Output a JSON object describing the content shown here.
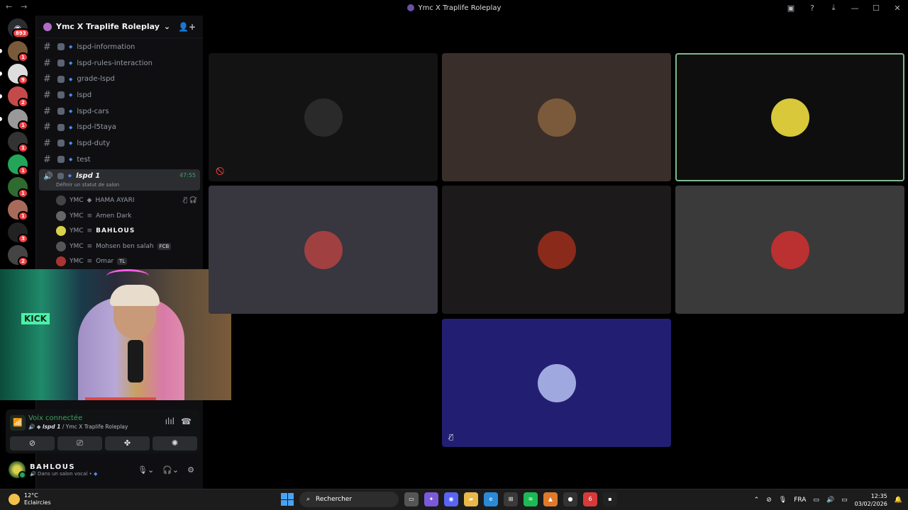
{
  "window": {
    "title": "Ymc X Traplife Roleplay",
    "back_icon": "←",
    "forward_icon": "→"
  },
  "rail": {
    "home_badge": "893",
    "servers": [
      {
        "badge": "1",
        "color": "#7a5a3a"
      },
      {
        "badge": "9",
        "color": "#ddd"
      },
      {
        "badge": "2",
        "color": "#c44a4a"
      },
      {
        "badge": "1",
        "color": "#999"
      },
      {
        "badge": "1",
        "color": "#333"
      },
      {
        "badge": "1",
        "color": "#23a55a"
      },
      {
        "badge": "1",
        "color": "#2f6a2f"
      },
      {
        "badge": "1",
        "color": "#a86a5a"
      },
      {
        "badge": "3",
        "color": "#222"
      },
      {
        "badge": "2",
        "color": "#444"
      }
    ]
  },
  "server": {
    "name": "Ymc X Traplife Roleplay",
    "chevron": "⌄",
    "add_member_icon": "👤+"
  },
  "channels": [
    {
      "name": "lspd-information"
    },
    {
      "name": "lspd-rules-interaction"
    },
    {
      "name": "grade-lspd"
    },
    {
      "name": "lspd"
    },
    {
      "name": "lspd-cars"
    },
    {
      "name": "lspd-l5taya"
    },
    {
      "name": "lspd-duty"
    },
    {
      "name": "test"
    }
  ],
  "voice_channel": {
    "name": "lspd 1",
    "timer": "47:55",
    "status": "Définir un statut de salon"
  },
  "members": [
    {
      "tag": "YMC",
      "name": "HAMA AYARI",
      "extra": "",
      "icons": "🎙̸ 🎧̸",
      "bold": false,
      "color": "#444"
    },
    {
      "tag": "YMC",
      "name": "Amen Dark",
      "extra": "",
      "icons": "",
      "bold": false,
      "color": "#666"
    },
    {
      "tag": "YMC",
      "name": "BAHLOUS",
      "extra": "",
      "icons": "",
      "bold": true,
      "color": "#d8d24a"
    },
    {
      "tag": "YMC",
      "name": "Mohsen ben salah",
      "extra": "FCB",
      "icons": "",
      "bold": false,
      "color": "#555"
    },
    {
      "tag": "YMC",
      "name": "Omar",
      "extra": "TL",
      "icons": "",
      "bold": false,
      "color": "#a33"
    }
  ],
  "webcam": {
    "sign": "KICK"
  },
  "voice_panel": {
    "connected": "Voix connectée",
    "location_channel": "lspd 1",
    "location_server": "/ Ymc X Traplife Roleplay"
  },
  "user": {
    "name": "BAHLOUS",
    "status": "Dans un salon vocal •"
  },
  "tiles": [
    {
      "bg": "#131313",
      "avatar": "#2a2a2a",
      "mute": "🚫"
    },
    {
      "bg": "#3a2e2b",
      "avatar": "#7a5a3a",
      "mute": ""
    },
    {
      "bg": "#0e0e0e",
      "avatar": "#d8c83a",
      "mute": ""
    },
    {
      "bg": "#38363f",
      "avatar": "#a04040",
      "mute": ""
    },
    {
      "bg": "#1d1a1c",
      "avatar": "#8a2a1a",
      "mute": ""
    },
    {
      "bg": "#3a3a3a",
      "avatar": "#bb3030",
      "mute": ""
    },
    {
      "bg": "#221f73",
      "avatar": "#a0a8e0",
      "mute": "🎙̸"
    }
  ],
  "taskbar": {
    "temp": "12°C",
    "weather": "Eclaircies",
    "search": "Rechercher",
    "lang": "FRA",
    "time": "12:35",
    "date": "03/02/2026"
  }
}
